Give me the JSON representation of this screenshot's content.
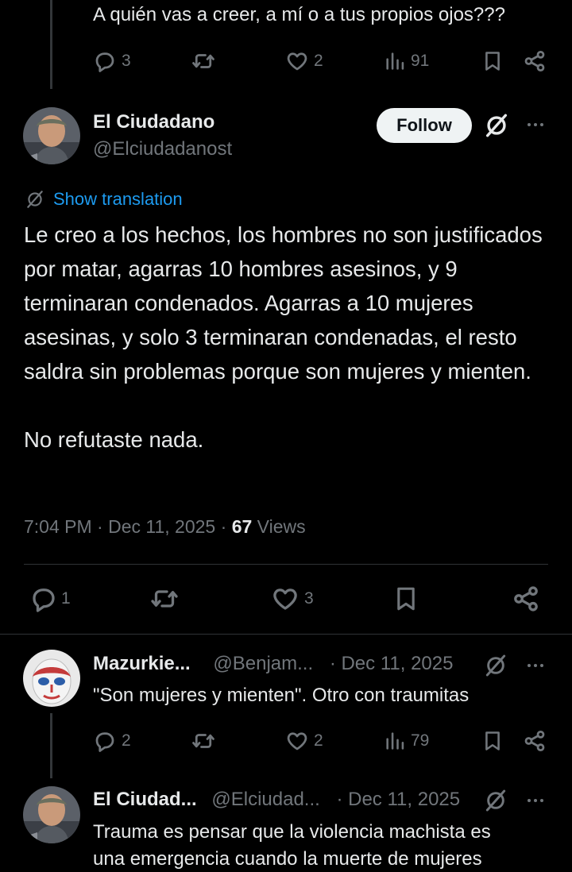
{
  "prev_tweet": {
    "text": "A quién vas a creer, a mí o a tus propios ojos???",
    "replies": "3",
    "likes": "2",
    "views": "91"
  },
  "main_tweet": {
    "display_name": "El Ciudadano",
    "handle": "@Elciudadanost",
    "follow_label": "Follow",
    "translation_label": "Show translation",
    "text": "Le creo a los hechos, los hombres no son justificados por matar, agarras 10 hombres asesinos, y 9 terminaran condenados. Agarras a 10 mujeres asesinas, y solo 3 terminaran condenadas, el resto saldra sin problemas porque son mujeres y mienten.\n\nNo refutaste nada.",
    "time": "7:04 PM",
    "separator": "·",
    "date": "Dec 11, 2025",
    "views_count": "67",
    "views_label": "Views",
    "replies": "1",
    "likes": "3"
  },
  "reply1": {
    "display_name": "Mazurkie...",
    "handle": "@Benjam...",
    "date": "· Dec 11, 2025",
    "text": "\"Son mujeres y mienten\". Otro con traumitas",
    "replies": "2",
    "likes": "2",
    "views": "79"
  },
  "reply2": {
    "display_name": "El Ciudad...",
    "handle": "@Elciudad...",
    "date": "· Dec 11, 2025",
    "text_line1": "Trauma es pensar que la violencia machista es",
    "text_line2": "una emergencia cuando la muerte de mujeres"
  },
  "colors": {
    "background": "#000000",
    "text": "#e7e9ea",
    "secondary": "#71767b",
    "link": "#1d9bf0",
    "follow_bg": "#eff3f4"
  },
  "icons": [
    "reply-icon",
    "retweet-icon",
    "like-icon",
    "views-icon",
    "bookmark-icon",
    "share-icon",
    "grok-icon",
    "more-icon",
    "translate-icon"
  ]
}
